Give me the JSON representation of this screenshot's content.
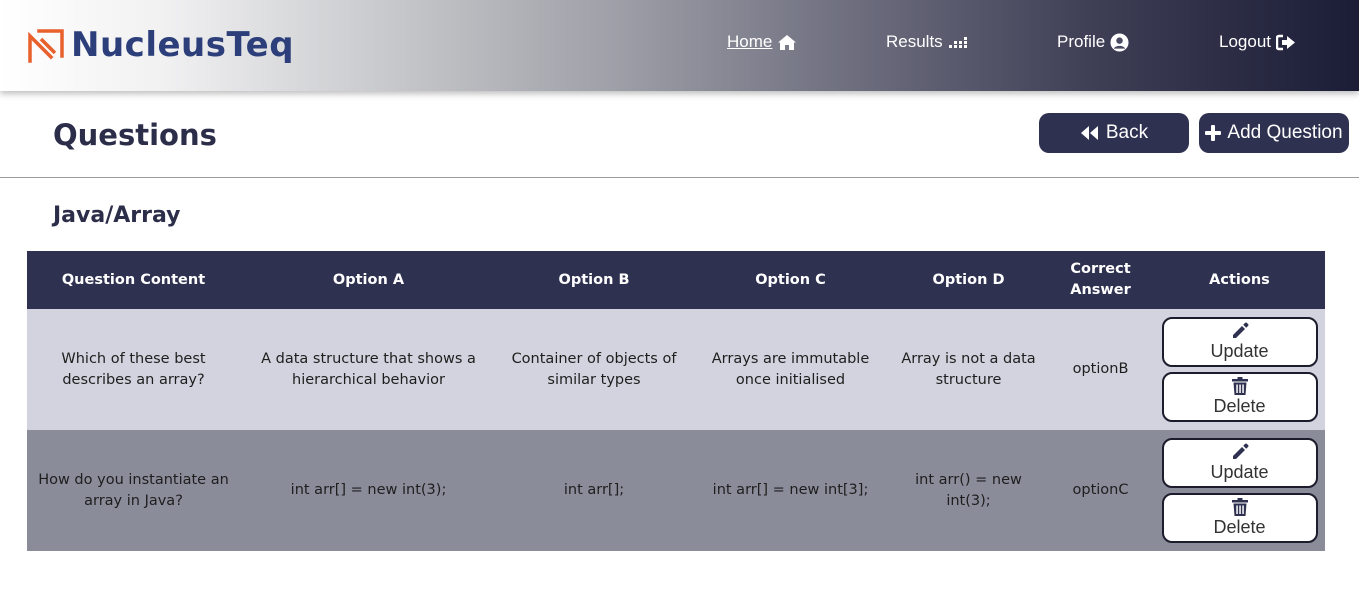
{
  "brand": {
    "name": "NucleusTeq",
    "color": "#2c3f7a",
    "accent": "#e8602c"
  },
  "nav": {
    "home": {
      "label": "Home",
      "icon": "home-icon"
    },
    "results": {
      "label": "Results",
      "icon": "results-chart-icon"
    },
    "profile": {
      "label": "Profile",
      "icon": "user-circle-icon"
    },
    "logout": {
      "label": "Logout",
      "icon": "sign-out-icon"
    }
  },
  "page": {
    "title": "Questions",
    "back_label": "Back",
    "add_label": "Add Question",
    "subtitle": "Java/Array"
  },
  "table": {
    "headers": {
      "content": "Question Content",
      "a": "Option A",
      "b": "Option B",
      "c": "Option C",
      "d": "Option D",
      "correct": "Correct Answer",
      "actions": "Actions"
    },
    "rows": [
      {
        "content": "Which of these best describes an array?",
        "a": "A data structure that shows a hierarchical behavior",
        "b": "Container of objects of similar types",
        "c": "Arrays are immutable once initialised",
        "d": "Array is not a data structure",
        "correct": "optionB",
        "update_label": "Update",
        "delete_label": "Delete"
      },
      {
        "content": "How do you instantiate an array in Java?",
        "a": "int arr[] = new int(3);",
        "b": "int arr[];",
        "c": "int arr[] = new int[3];",
        "d": "int arr() = new int(3);",
        "correct": "optionC",
        "update_label": "Update",
        "delete_label": "Delete"
      }
    ]
  },
  "colors": {
    "header_dark": "#1b1c36",
    "button_dark": "#2f3150",
    "row_light": "#d3d3df",
    "row_dark": "#8b8c9a"
  }
}
